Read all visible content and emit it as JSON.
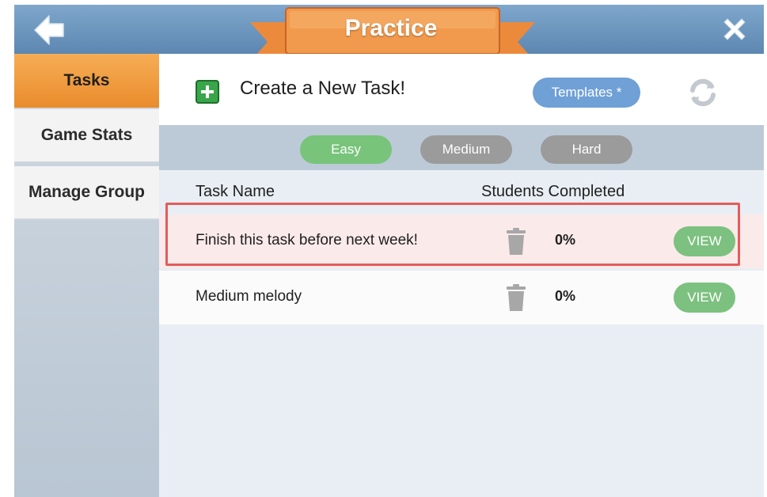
{
  "header": {
    "title": "Practice",
    "back_icon": "arrow-left-icon",
    "close_icon": "close-icon",
    "colors": {
      "header_bg": "#6e97bf",
      "ribbon": "#ec8a3c",
      "ribbon_dark": "#c86427"
    }
  },
  "sidebar": {
    "items": [
      {
        "label": "Tasks",
        "active": true
      },
      {
        "label": "Game Stats",
        "active": false
      },
      {
        "label": "Manage Group",
        "active": false
      }
    ]
  },
  "main": {
    "create_label": "Create a New Task!",
    "create_icon": "plus-icon",
    "templates_label": "Templates *",
    "refresh_icon": "refresh-icon",
    "difficulty": {
      "options": [
        "Easy",
        "Medium",
        "Hard"
      ],
      "selected": "Easy"
    },
    "columns": {
      "task_name": "Task Name",
      "students_completed": "Students Completed"
    },
    "tasks": [
      {
        "name": "Finish this task before next week!",
        "completed": "0%",
        "view_label": "VIEW",
        "highlighted": true
      },
      {
        "name": "Medium melody",
        "completed": "0%",
        "view_label": "VIEW",
        "highlighted": false
      }
    ],
    "colors": {
      "accent_green": "#77c47a",
      "accent_blue": "#6fa0d6",
      "highlight_border": "#e35c5c"
    }
  }
}
